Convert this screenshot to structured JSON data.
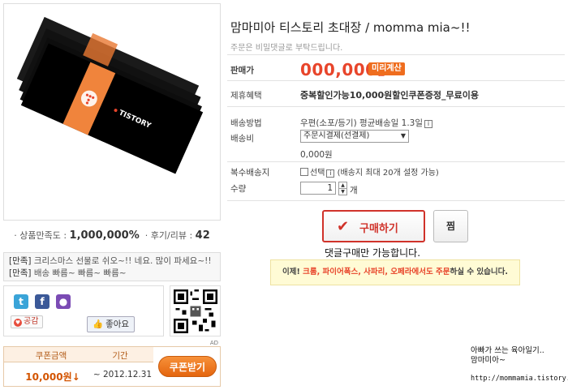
{
  "product": {
    "title": "맘마미아 티스토리 초대장 / momma mia~!!",
    "note": "주문은 비밀댓글로 부탁드립니다.",
    "image_brand": "TISTORY"
  },
  "satisfaction": {
    "label": "· 상품만족도 :",
    "value": "1,000,000%",
    "reviews_label": "· 후기/리뷰 :",
    "reviews_count": "42"
  },
  "reviews": [
    {
      "tag": "[만족]",
      "text": " 크리스마스 선물로 쉬오~!! 네요. 많이 파세요~!!"
    },
    {
      "tag": "[만족]",
      "text": " 배송 빠름~ 빠름~ 빠름~"
    }
  ],
  "share": {
    "empathy_label": "공감",
    "like_label": "좋아요",
    "icons": [
      "twitter-icon",
      "facebook-icon",
      "me2day-icon",
      "empathy-icon",
      "like-icon",
      "qr-code"
    ]
  },
  "coupon": {
    "ad_tag": "AD",
    "col_amount": "쿠폰금액",
    "col_period": "기간",
    "amount": "10,000원↓",
    "period": "~ 2012.12.31",
    "button": "쿠폰받기"
  },
  "info": {
    "price_label": "판매가",
    "price": "000,000",
    "price_unit": "원",
    "calc_button": "미리계산",
    "benefit_label": "제휴혜택",
    "benefit": "중복할인가능10,000원할인쿠폰증정_무료이용",
    "ship_method_label": "배송방법",
    "ship_method": "우편(소포/등기)  평균배송일 1.3일",
    "ship_cost_label": "배송비",
    "ship_select": "주문시결제(선결제)",
    "ship_cost": "0,000원",
    "multi_ship_label": "복수배송지",
    "multi_ship_text": "선택",
    "multi_ship_note": " (배송지 최대 20개 설정 가능)",
    "qty_label": "수량",
    "qty": "1",
    "qty_unit": "개"
  },
  "actions": {
    "buy": "구매하기",
    "wish": "찜",
    "comment_note": "댓글구매만 가능합니다."
  },
  "notice": {
    "prefix": "이제! ",
    "browsers": "크롬, 파이어폭스, 사파리, 오페라에서도 주문",
    "suffix": "하실 수 있습니다."
  },
  "blog": {
    "title_line1": "아빠가 쓰는 육아일기..",
    "title_line2": "맘마미아~",
    "url": "http://mommamia.tistory.com"
  },
  "colors": {
    "accent": "#e8452b",
    "buy_border": "#d0322a",
    "coupon_orange": "#ef6d1e",
    "notice_bg": "#fffbd5"
  }
}
